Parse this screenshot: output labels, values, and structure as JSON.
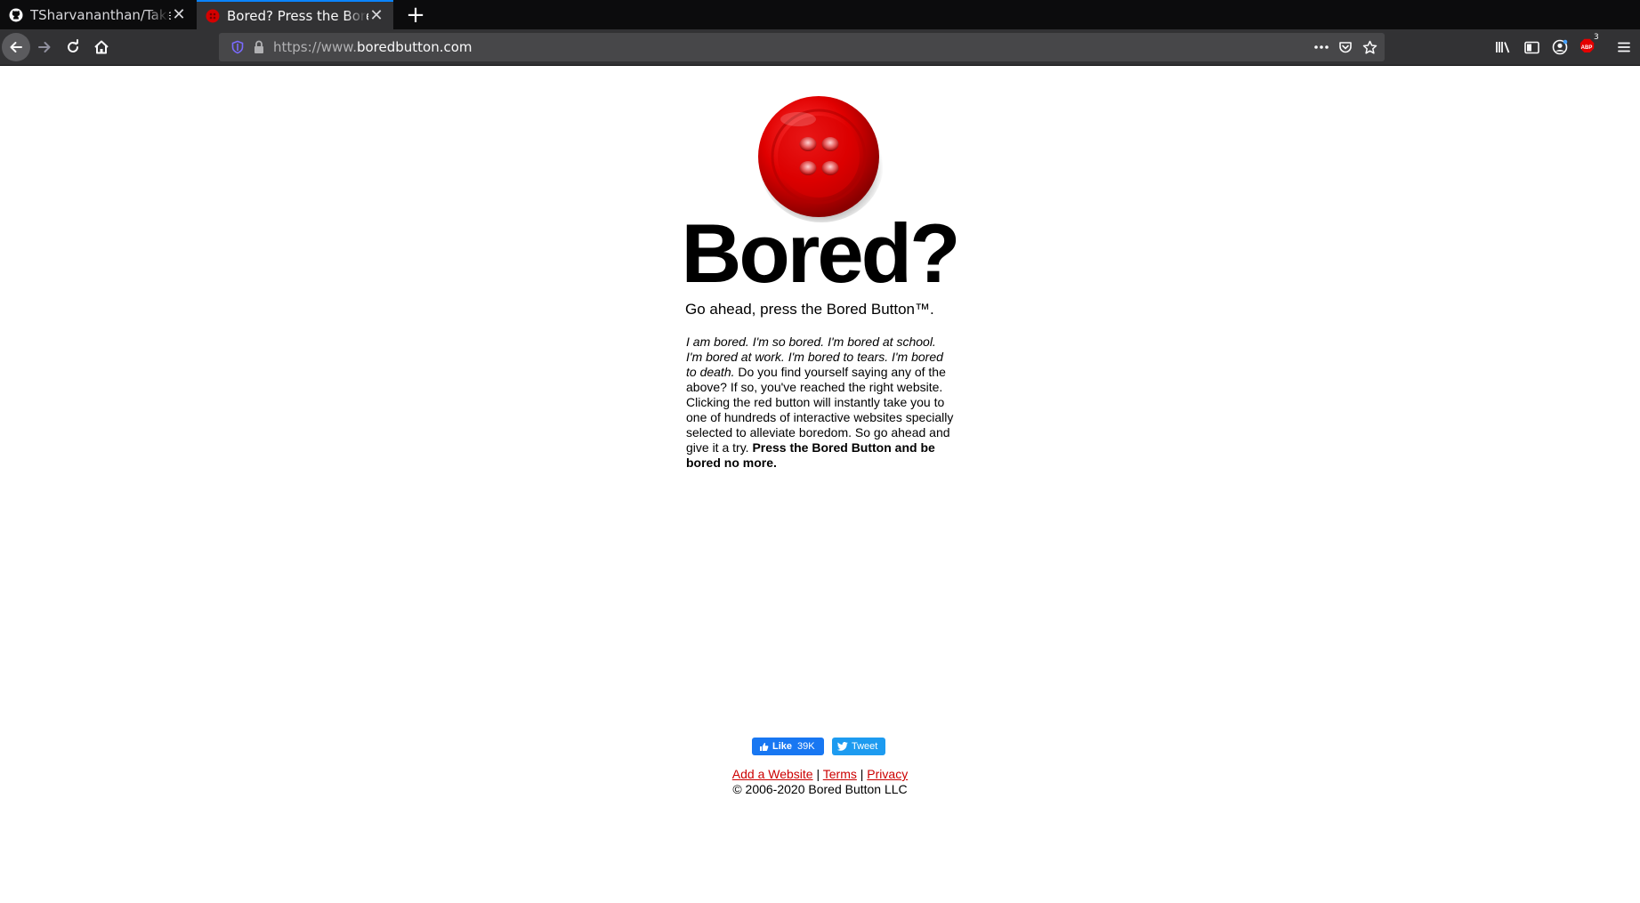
{
  "browser": {
    "tabs": [
      {
        "title": "TSharvananthan/TakeMe",
        "active": false
      },
      {
        "title": "Bored? Press the Bored B",
        "active": true
      }
    ],
    "url": {
      "scheme": "https://www.",
      "host": "boredbutton.com"
    },
    "adblock_badge": "3"
  },
  "page": {
    "headline": "Bored?",
    "tagline": "Go ahead, press the Bored Button™.",
    "blurb": {
      "italic": "I am bored. I'm so bored. I'm bored at school. I'm bored at work. I'm bored to tears. I'm bored to death.",
      "body": " Do you find yourself saying any of the above? If so, you've reached the right website. Clicking the red button will instantly take you to one of hundreds of interactive websites specially selected to alleviate boredom. So go ahead and give it a try. ",
      "bold": "Press the Bored Button and be bored no more."
    },
    "social": {
      "like_label": "Like",
      "like_count": "39K",
      "tweet_label": "Tweet"
    },
    "footer": {
      "add_website": "Add a Website",
      "sep": "|",
      "terms": "Terms",
      "privacy": "Privacy",
      "copyright": "© 2006-2020 Bored Button LLC"
    }
  },
  "colors": {
    "button_red": "#e00000",
    "link_red": "#cc0000",
    "facebook_blue": "#1877f2",
    "twitter_blue": "#1d9bf0"
  }
}
